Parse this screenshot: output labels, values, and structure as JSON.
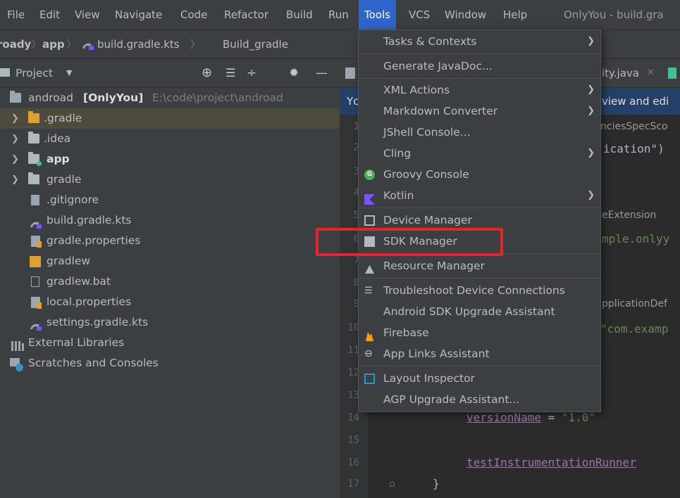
{
  "menubar": {
    "items": [
      "File",
      "Edit",
      "View",
      "Navigate",
      "Code",
      "Refactor",
      "Build",
      "Run",
      "Tools",
      "VCS",
      "Window",
      "Help"
    ],
    "window_title": "OnlyYou - build.gra"
  },
  "navbar": {
    "crumbs": [
      "roady",
      "app",
      "build.gradle.kts"
    ],
    "active_tab": "Build_gradle"
  },
  "project_panel": {
    "title": "Project",
    "tree": [
      {
        "label": "androad",
        "bold": "[OnlyYou]",
        "path": "E:\\code\\project\\androad"
      },
      {
        "label": ".gradle"
      },
      {
        "label": ".idea"
      },
      {
        "label": "app"
      },
      {
        "label": "gradle"
      },
      {
        "label": ".gitignore"
      },
      {
        "label": "build.gradle.kts"
      },
      {
        "label": "gradle.properties"
      },
      {
        "label": "gradlew"
      },
      {
        "label": "gradlew.bat"
      },
      {
        "label": "local.properties"
      },
      {
        "label": "settings.gradle.kts"
      },
      {
        "label": "External Libraries"
      },
      {
        "label": "Scratches and Consoles"
      }
    ]
  },
  "editor": {
    "tab": "ity.java",
    "banner_left": "Yc",
    "banner_right": "view and edi",
    "line_numbers": [
      "1",
      "2",
      "3",
      "4",
      "5",
      "6",
      "7",
      "8",
      "9",
      "10",
      "11",
      "12",
      "13",
      "14",
      "15",
      "16",
      "17"
    ],
    "snippets": {
      "l1": "nciesSpecSco",
      "l2": "ication\")",
      "l5": "eExtension",
      "l6": "mple.onlyy",
      "l9": "pplicationDef",
      "l10": "\"com.examp",
      "l14_key": "versionName",
      "l14_eq": " = ",
      "l14_val": "\"1.0\"",
      "l16_key": "testInstrumentationRunner",
      "l17": "}"
    }
  },
  "tools_menu": {
    "items": [
      {
        "label": "Tasks & Contexts",
        "submenu": true
      },
      {
        "label": "Generate JavaDoc..."
      },
      {
        "label": "XML Actions",
        "submenu": true
      },
      {
        "label": "Markdown Converter",
        "submenu": true
      },
      {
        "label": "JShell Console..."
      },
      {
        "label": "Cling",
        "submenu": true
      },
      {
        "label": "Groovy Console"
      },
      {
        "label": "Kotlin",
        "submenu": true
      },
      {
        "label": "Device Manager"
      },
      {
        "label": "SDK Manager"
      },
      {
        "label": "Resource Manager"
      },
      {
        "label": "Troubleshoot Device Connections"
      },
      {
        "label": "Android SDK Upgrade Assistant"
      },
      {
        "label": "Firebase"
      },
      {
        "label": "App Links Assistant"
      },
      {
        "label": "Layout Inspector"
      },
      {
        "label": "AGP Upgrade Assistant..."
      }
    ]
  },
  "colors": {
    "accent": "#2f65ca",
    "highlight_box": "#e8242a"
  }
}
